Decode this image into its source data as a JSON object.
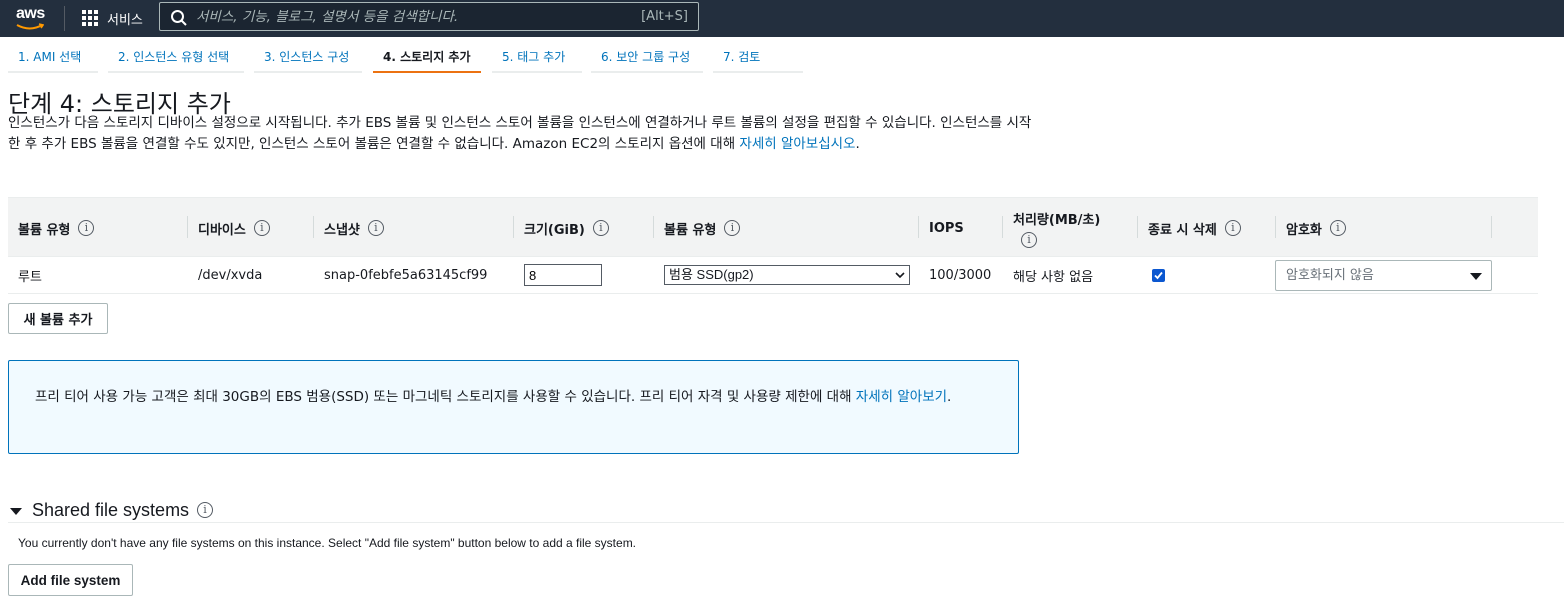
{
  "topbar": {
    "logo_text": "aws",
    "services_label": "서비스",
    "search_placeholder": "서비스, 기능, 블로그, 설명서 등을 검색합니다.",
    "shortcut": "[Alt+S]"
  },
  "steps": [
    {
      "label": "1. AMI 선택"
    },
    {
      "label": "2. 인스턴스 유형 선택"
    },
    {
      "label": "3. 인스턴스 구성"
    },
    {
      "label": "4. 스토리지 추가"
    },
    {
      "label": "5. 태그 추가"
    },
    {
      "label": "6. 보안 그룹 구성"
    },
    {
      "label": "7. 검토"
    }
  ],
  "page_title": "단계 4: 스토리지 추가",
  "description": {
    "text": "인스턴스가 다음 스토리지 디바이스 설정으로 시작됩니다. 추가 EBS 볼륨 및 인스턴스 스토어 볼륨을 인스턴스에 연결하거나 루트 볼륨의 설정을 편집할 수 있습니다. 인스턴스를 시작한 후 추가 EBS 볼륨을 연결할 수도 있지만, 인스턴스 스토어 볼륨은 연결할 수 없습니다. Amazon EC2의 스토리지 옵션에 대해 ",
    "link": "자세히 알아보십시오",
    "end": "."
  },
  "table": {
    "info_glyph": "i",
    "headers": {
      "volume_type": "볼륨 유형",
      "device": "디바이스",
      "snapshot": "스냅샷",
      "size": "크기(GiB)",
      "ebs_type": "볼륨 유형",
      "iops": "IOPS",
      "throughput": "처리량(MB/초)",
      "delete": "종료 시 삭제",
      "encryption": "암호화"
    },
    "row": {
      "volume_type": "루트",
      "device": "/dev/xvda",
      "snapshot": "snap-0febfe5a63145cf99",
      "size": "8",
      "ebs_type": "범용 SSD(gp2)",
      "iops": "100/3000",
      "throughput": "해당 사항 없음",
      "delete_on_termination": true,
      "encryption": "암호화되지 않음"
    }
  },
  "add_volume_button": "새 볼륨 추가",
  "notice": {
    "text": "프리 티어 사용 가능 고객은 최대 30GB의 EBS 범용(SSD) 또는 마그네틱 스토리지를 사용할 수 있습니다. 프리 티어 자격 및 사용량 제한에 대해 ",
    "link": "자세히 알아보기",
    "end": "."
  },
  "shared_fs": {
    "title": "Shared file systems",
    "info_glyph": "i",
    "message": "You currently don't have any file systems on this instance. Select \"Add file system\" button below to add a file system.",
    "add_button": "Add file system"
  },
  "colors": {
    "topbar_bg": "#232f3e",
    "link": "#0073bb",
    "active_tab": "#ec7211"
  }
}
